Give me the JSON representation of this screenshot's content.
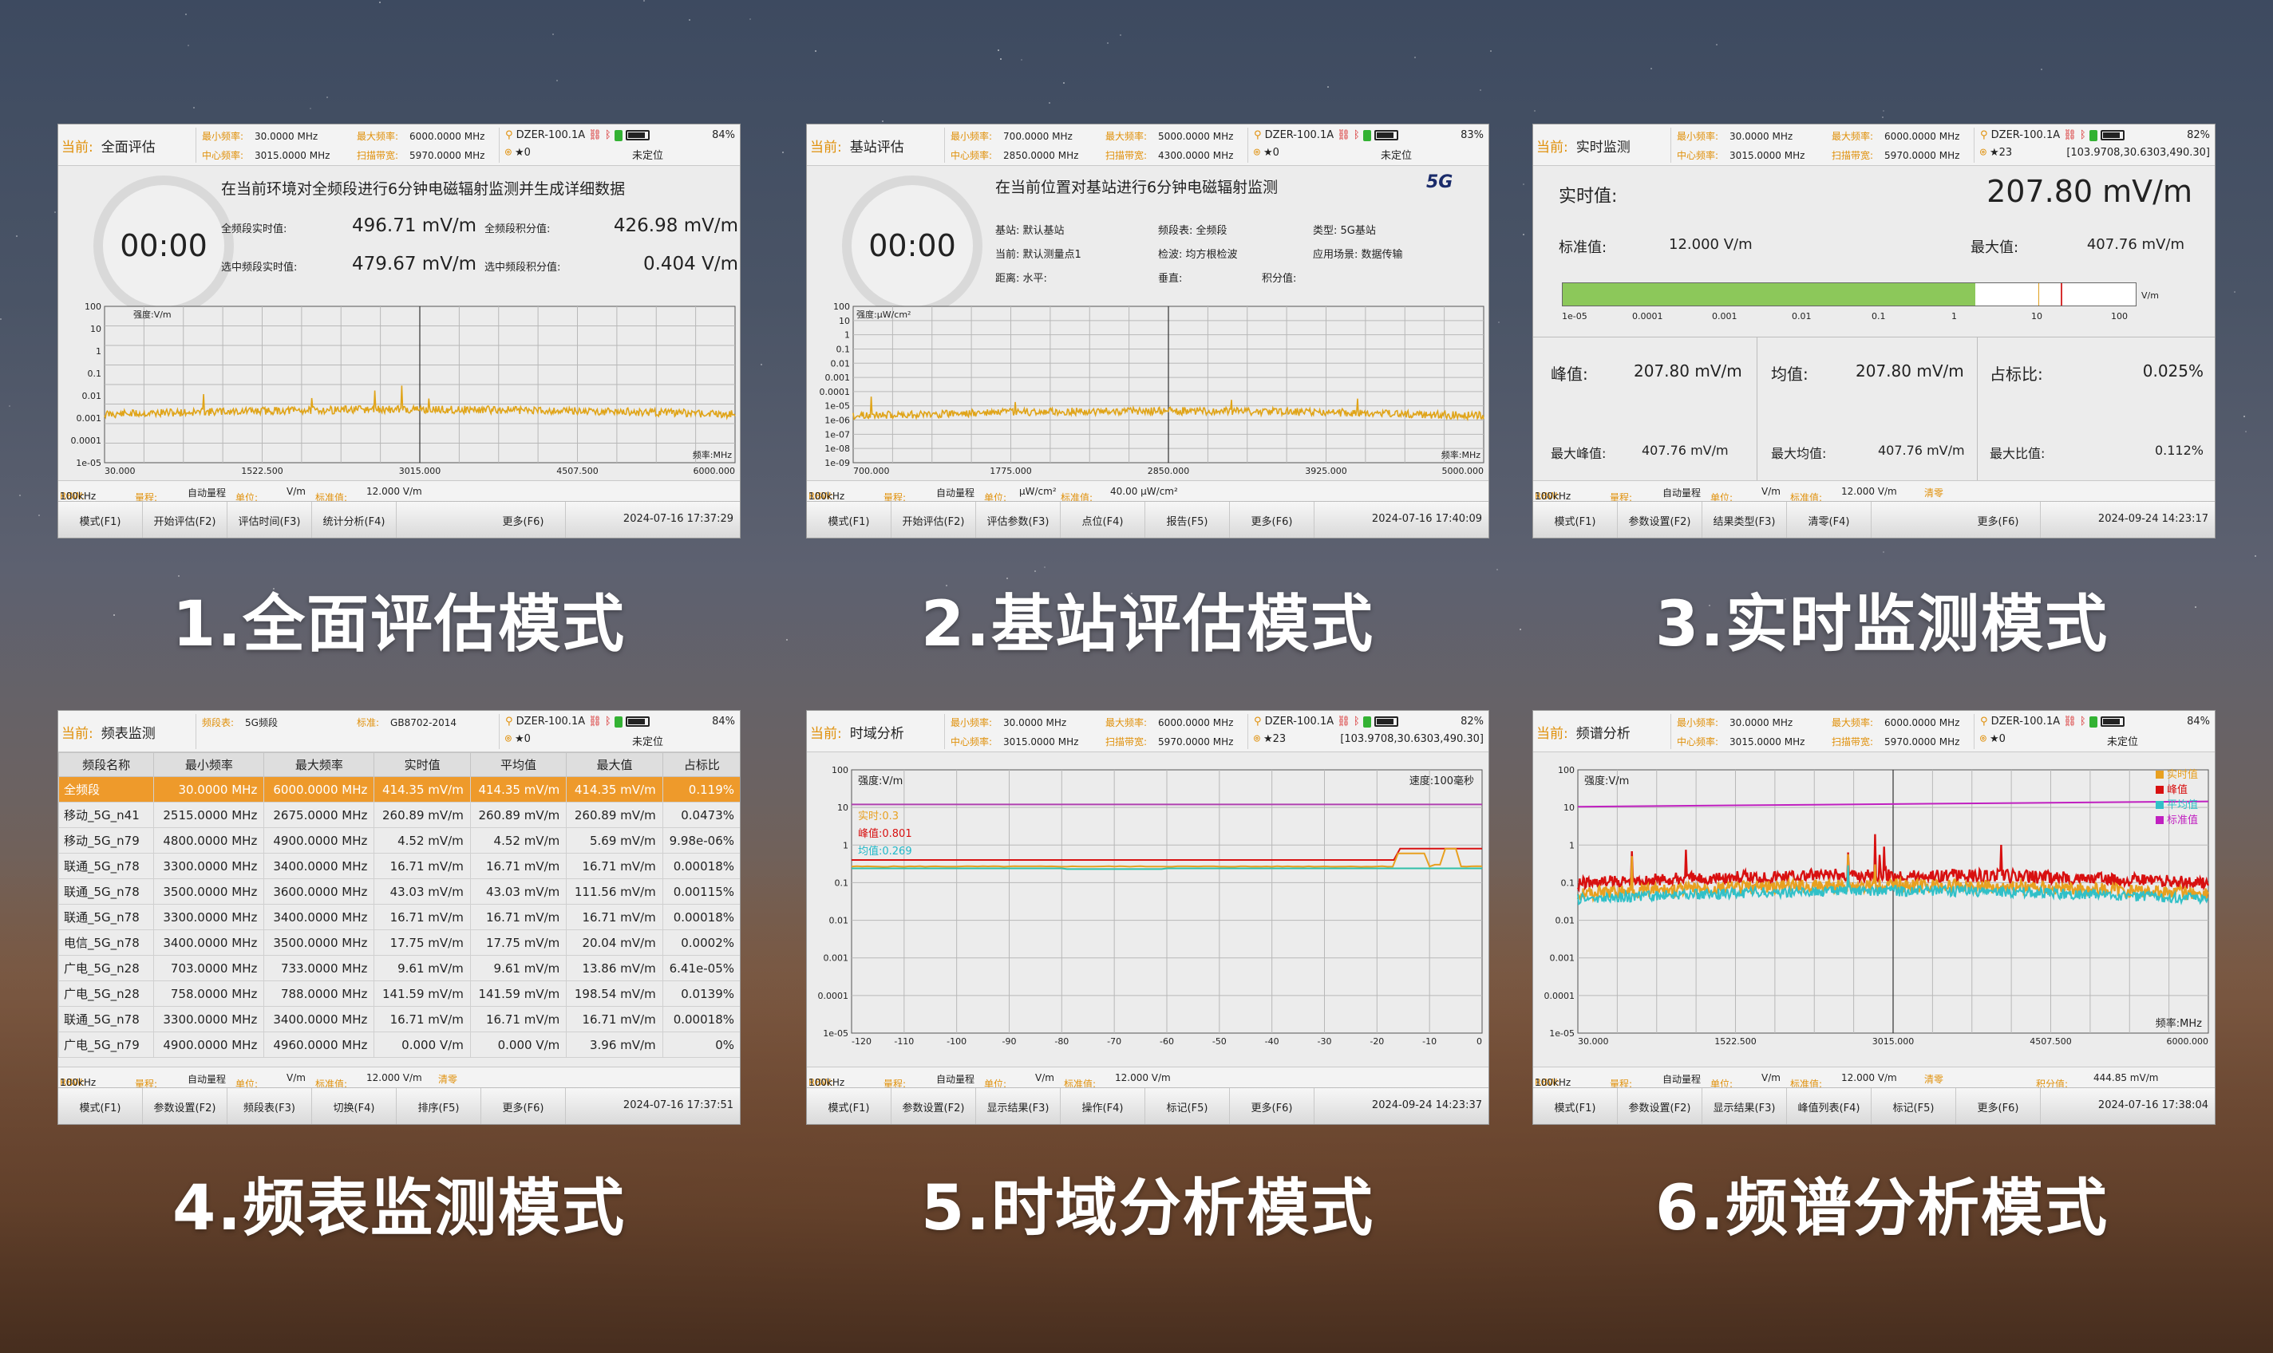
{
  "captions": [
    "1.全面评估模式",
    "2.基站评估模式",
    "3.实时监测模式",
    "4.频表监测模式",
    "5.时域分析模式",
    "6.频谱分析模式"
  ],
  "common": {
    "cur_label": "当前:",
    "min_freq_label": "最小频率:",
    "max_freq_label": "最大频率:",
    "center_label": "中心频率:",
    "span_label": "扫描带宽:",
    "rbw_label": "RBW:",
    "range_label": "量程:",
    "unit_label": "单位:",
    "std_label": "标准值:",
    "auto_range": "自动量程",
    "device": "DZER-100.1A",
    "star_label": "★",
    "clear_label": "清零"
  },
  "p1": {
    "mode": "全面评估",
    "min_freq": "30.0000 MHz",
    "max_freq": "6000.0000 MHz",
    "center": "3015.0000 MHz",
    "span": "5970.0000 MHz",
    "battery": "84%",
    "sats": "0",
    "loc": "未定位",
    "timer": "00:00",
    "desc": "在当前环境对全频段进行6分钟电磁辐射监测并生成详细数据",
    "l1": "全频段实时值:",
    "v1": "496.71 mV/m",
    "l2": "全频段积分值:",
    "v2": "426.98 mV/m",
    "l3": "选中频段实时值:",
    "v3": "479.67 mV/m",
    "l4": "选中频段积分值:",
    "v4": "0.404 V/m",
    "y_unit": "强度:V/m",
    "x_unit": "频率:MHz",
    "yticks": [
      "100",
      "10",
      "1",
      "0.1",
      "0.01",
      "0.001",
      "0.0001",
      "1e-05"
    ],
    "xticks": [
      "30.000",
      "1522.500",
      "3015.000",
      "4507.500",
      "6000.000"
    ],
    "rbw": "100kHz",
    "unit": "V/m",
    "std": "12.000 V/m",
    "buttons": [
      "模式(F1)",
      "开始评估(F2)",
      "评估时间(F3)",
      "统计分析(F4)",
      "更多(F6)"
    ],
    "time": "2024-07-16 17:37:29"
  },
  "p2": {
    "mode": "基站评估",
    "min_freq": "700.0000 MHz",
    "max_freq": "5000.0000 MHz",
    "center": "2850.0000 MHz",
    "span": "4300.0000 MHz",
    "battery": "83%",
    "sats": "0",
    "loc": "未定位",
    "timer": "00:00",
    "desc": "在当前位置对基站进行6分钟电磁辐射监测",
    "badge": "5G",
    "r1": [
      "基站: 默认基站",
      "频段表: 全频段",
      "类型: 5G基站"
    ],
    "r2": [
      "当前: 默认测量点1",
      "检波: 均方根检波",
      "应用场景: 数据传输"
    ],
    "r3": [
      "距离:  水平:",
      "垂直:",
      "积分值:"
    ],
    "y_unit": "强度:μW/cm²",
    "x_unit": "频率:MHz",
    "yticks": [
      "100",
      "10",
      "1",
      "0.1",
      "0.01",
      "0.001",
      "0.0001",
      "1e-05",
      "1e-06",
      "1e-07",
      "1e-08",
      "1e-09"
    ],
    "xticks": [
      "700.000",
      "1775.000",
      "2850.000",
      "3925.000",
      "5000.000"
    ],
    "rbw": "100kHz",
    "unit": "μW/cm²",
    "std": "40.00 μW/cm²",
    "buttons": [
      "模式(F1)",
      "开始评估(F2)",
      "评估参数(F3)",
      "点位(F4)",
      "报告(F5)",
      "更多(F6)"
    ],
    "time": "2024-07-16 17:40:09"
  },
  "p3": {
    "mode": "实时监测",
    "min_freq": "30.0000 MHz",
    "max_freq": "6000.0000 MHz",
    "center": "3015.0000 MHz",
    "span": "5970.0000 MHz",
    "battery": "82%",
    "sats": "23",
    "loc": "[103.9708,30.6303,490.30]",
    "rt_label": "实时值:",
    "rt_value": "207.80 mV/m",
    "std_l": "标准值:",
    "std_v": "12.000 V/m",
    "max_l": "最大值:",
    "max_v": "407.76 mV/m",
    "bar_unit": "V/m",
    "bar_level": 0.72,
    "bar_ticks": [
      "1e-05",
      "0.0001",
      "0.001",
      "0.01",
      "0.1",
      "1",
      "10",
      "100"
    ],
    "peak_l": "峰值:",
    "peak_v": "207.80 mV/m",
    "avg_l": "均值:",
    "avg_v": "207.80 mV/m",
    "occ_l": "占标比:",
    "occ_v": "0.025%",
    "mpeak_l": "最大峰值:",
    "mpeak_v": "407.76 mV/m",
    "mavg_l": "最大均值:",
    "mavg_v": "407.76 mV/m",
    "mocc_l": "最大比值:",
    "mocc_v": "0.112%",
    "rbw": "100kHz",
    "unit": "V/m",
    "std": "12.000 V/m",
    "buttons": [
      "模式(F1)",
      "参数设置(F2)",
      "结果类型(F3)",
      "清零(F4)",
      "更多(F6)"
    ],
    "time": "2024-09-24 14:23:17"
  },
  "p4": {
    "band_label": "频段表:",
    "band": "5G频段",
    "std_label": "标准:",
    "std_name": "GB8702-2014",
    "mode": "频表监测",
    "battery": "84%",
    "sats": "0",
    "loc": "未定位",
    "headers": [
      "频段名称",
      "最小频率",
      "最大频率",
      "实时值",
      "平均值",
      "最大值",
      "占标比"
    ],
    "rows": [
      [
        "全频段",
        "30.0000 MHz",
        "6000.0000 MHz",
        "414.35 mV/m",
        "414.35 mV/m",
        "414.35 mV/m",
        "0.119%"
      ],
      [
        "移动_5G_n41",
        "2515.0000 MHz",
        "2675.0000 MHz",
        "260.89 mV/m",
        "260.89 mV/m",
        "260.89 mV/m",
        "0.0473%"
      ],
      [
        "移动_5G_n79",
        "4800.0000 MHz",
        "4900.0000 MHz",
        "4.52 mV/m",
        "4.52 mV/m",
        "5.69 mV/m",
        "9.98e-06%"
      ],
      [
        "联通_5G_n78",
        "3300.0000 MHz",
        "3400.0000 MHz",
        "16.71 mV/m",
        "16.71 mV/m",
        "16.71 mV/m",
        "0.00018%"
      ],
      [
        "联通_5G_n78",
        "3500.0000 MHz",
        "3600.0000 MHz",
        "43.03 mV/m",
        "43.03 mV/m",
        "111.56 mV/m",
        "0.00115%"
      ],
      [
        "联通_5G_n78",
        "3300.0000 MHz",
        "3400.0000 MHz",
        "16.71 mV/m",
        "16.71 mV/m",
        "16.71 mV/m",
        "0.00018%"
      ],
      [
        "电信_5G_n78",
        "3400.0000 MHz",
        "3500.0000 MHz",
        "17.75 mV/m",
        "17.75 mV/m",
        "20.04 mV/m",
        "0.0002%"
      ],
      [
        "广电_5G_n28",
        "703.0000 MHz",
        "733.0000 MHz",
        "9.61 mV/m",
        "9.61 mV/m",
        "13.86 mV/m",
        "6.41e-05%"
      ],
      [
        "广电_5G_n28",
        "758.0000 MHz",
        "788.0000 MHz",
        "141.59 mV/m",
        "141.59 mV/m",
        "198.54 mV/m",
        "0.0139%"
      ],
      [
        "联通_5G_n78",
        "3300.0000 MHz",
        "3400.0000 MHz",
        "16.71 mV/m",
        "16.71 mV/m",
        "16.71 mV/m",
        "0.00018%"
      ],
      [
        "广电_5G_n79",
        "4900.0000 MHz",
        "4960.0000 MHz",
        "0.000 V/m",
        "0.000 V/m",
        "3.96 mV/m",
        "0%"
      ]
    ],
    "rbw": "100kHz",
    "unit": "V/m",
    "std": "12.000 V/m",
    "buttons": [
      "模式(F1)",
      "参数设置(F2)",
      "频段表(F3)",
      "切换(F4)",
      "排序(F5)",
      "更多(F6)"
    ],
    "time": "2024-07-16 17:37:51"
  },
  "p5": {
    "mode": "时域分析",
    "min_freq": "30.0000 MHz",
    "max_freq": "6000.0000 MHz",
    "center": "3015.0000 MHz",
    "span": "5970.0000 MHz",
    "battery": "82%",
    "sats": "23",
    "loc": "[103.9708,30.6303,490.30]",
    "y_unit": "强度:V/m",
    "speed": "速度:100毫秒",
    "rt_label": "实时:0.3",
    "peak_label": "峰值:0.801",
    "avg_label": "均值:0.269",
    "yticks": [
      "100",
      "10",
      "1",
      "0.1",
      "0.01",
      "0.001",
      "0.0001",
      "1e-05"
    ],
    "xticks": [
      "-120",
      "-110",
      "-100",
      "-90",
      "-80",
      "-70",
      "-60",
      "-50",
      "-40",
      "-30",
      "-20",
      "-10",
      "0"
    ],
    "rbw": "100kHz",
    "unit": "V/m",
    "std": "12.000 V/m",
    "buttons": [
      "模式(F1)",
      "参数设置(F2)",
      "显示结果(F3)",
      "操作(F4)",
      "标记(F5)",
      "更多(F6)"
    ],
    "time": "2024-09-24 14:23:37"
  },
  "p6": {
    "mode": "频谱分析",
    "min_freq": "30.0000 MHz",
    "max_freq": "6000.0000 MHz",
    "center": "3015.0000 MHz",
    "span": "5970.0000 MHz",
    "battery": "84%",
    "sats": "0",
    "loc": "未定位",
    "y_unit": "强度:V/m",
    "x_unit": "频率:MHz",
    "legend": [
      "实时值",
      "峰值",
      "平均值",
      "标准值"
    ],
    "legend_colors": [
      "#e8a020",
      "#d81010",
      "#30c0c8",
      "#c020c0"
    ],
    "yticks": [
      "100",
      "10",
      "1",
      "0.1",
      "0.01",
      "0.001",
      "0.0001",
      "1e-05"
    ],
    "xticks": [
      "30.000",
      "1522.500",
      "3015.000",
      "4507.500",
      "6000.000"
    ],
    "rbw": "100kHz",
    "unit": "V/m",
    "std": "12.000 V/m",
    "int_label": "积分值:",
    "int_value": "444.85 mV/m",
    "buttons": [
      "模式(F1)",
      "参数设置(F2)",
      "显示结果(F3)",
      "峰值列表(F4)",
      "标记(F5)",
      "更多(F6)"
    ],
    "time": "2024-07-16 17:38:04"
  }
}
